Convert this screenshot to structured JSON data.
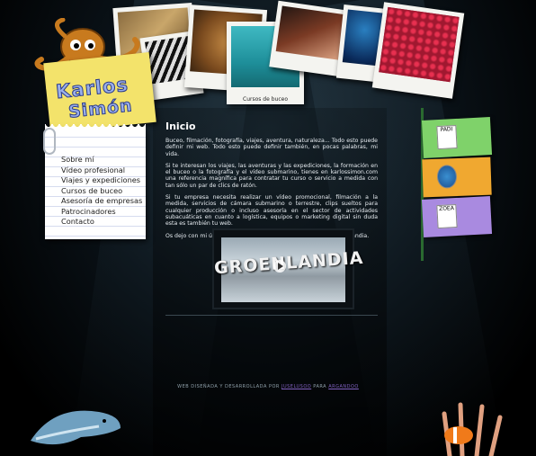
{
  "logo": {
    "line1": "Karlos",
    "line2": "Simón"
  },
  "polaroids": [
    {
      "name": "polaroid-fish",
      "caption": ""
    },
    {
      "name": "polaroid-zebra",
      "caption": ""
    },
    {
      "name": "polaroid-lion",
      "caption": ""
    },
    {
      "name": "polaroid-diving-course",
      "caption": "Cursos de buceo"
    },
    {
      "name": "polaroid-lionfish",
      "caption": ""
    },
    {
      "name": "polaroid-diver",
      "caption": ""
    },
    {
      "name": "polaroid-coral",
      "caption": ""
    }
  ],
  "nav": {
    "items": [
      "Sobre mí",
      "Vídeo profesional",
      "Viajes y expediciones",
      "Cursos de buceo",
      "Asesoría de empresas",
      "Patrocinadores",
      "Contacto"
    ]
  },
  "main": {
    "title": "Inicio",
    "p1": "Buceo, filmación, fotografía, viajes, aventura, naturaleza... Todo esto puede definir mi web. Todo esto puede definir también, en pocas palabras, mi vida.",
    "p2": "Si te interesan los viajes, las aventuras y las expediciones, la formación en el buceo o la fotografía y el vídeo submarino, tienes en karlossimon.com una referencia magnífica para contratar tu curso o servicio a medida con tan sólo un par de clics de ratón.",
    "p3": "Si tu empresa necesita realizar un vídeo promocional, filmación a la medida, servicios de cámara submarino o terrestre, clips sueltos para cualquier producción o incluso asesoría en el sector de actividades subacuáticas en cuanto a logística, equipos o marketing digital sin duda esta es también tu web.",
    "p4": "Os dejo con mi último vídeo filmado para Tierras Polares en Groenlandia.",
    "video_title": "GROENLANDIA"
  },
  "footer": {
    "text": "WEB DISEÑADA Y DESARROLLADA POR",
    "link1": "JUSELUSOO",
    "mid": "PARA",
    "link2": "ARGANDOO"
  },
  "sponsors": [
    {
      "name": "padi",
      "label": "PADI",
      "color": "#7fd26a"
    },
    {
      "name": "globe",
      "label": "",
      "color": "#f0a830"
    },
    {
      "name": "zoea",
      "label": "ZOEA",
      "color": "#a98ae0"
    }
  ]
}
